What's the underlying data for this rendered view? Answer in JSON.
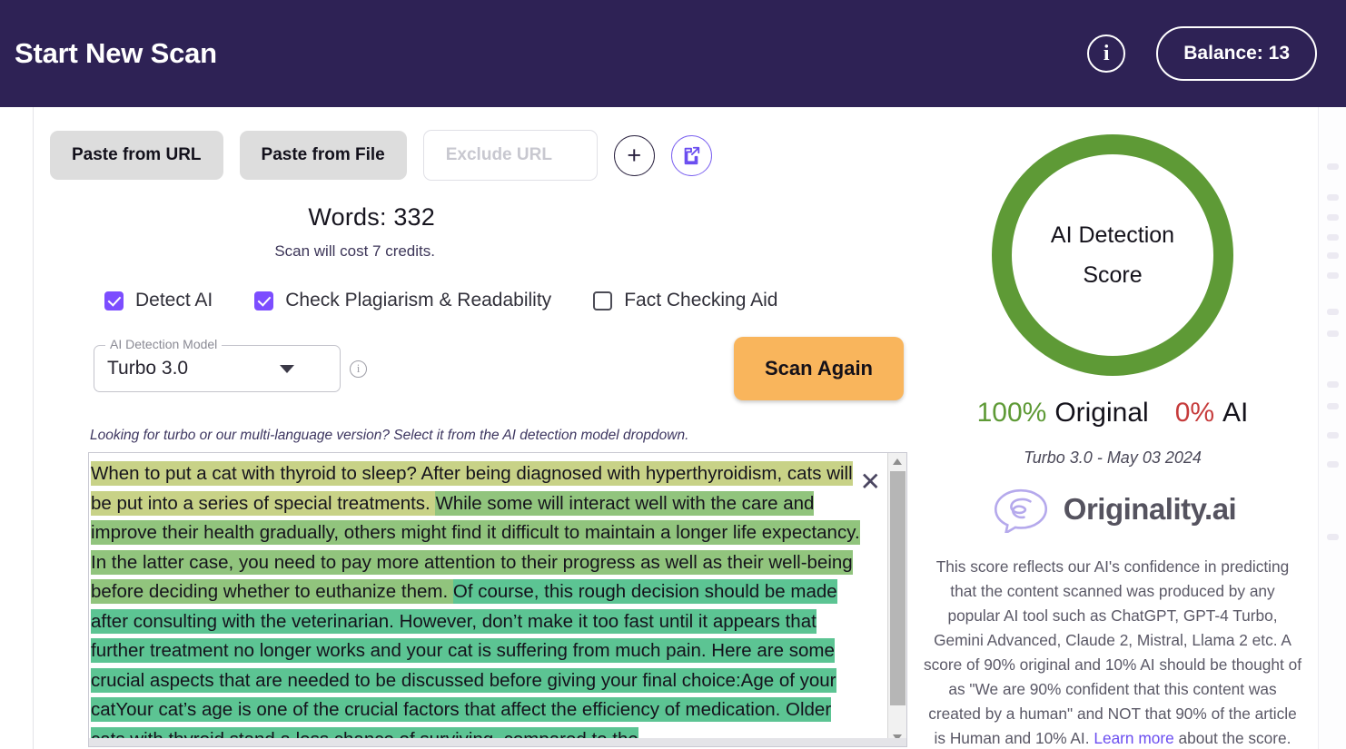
{
  "header": {
    "title": "Start New Scan",
    "info_icon": "info-icon",
    "balance_label": "Balance: 13"
  },
  "toolbar": {
    "paste_url": "Paste from URL",
    "paste_file": "Paste from File",
    "exclude_url_placeholder": "Exclude URL",
    "add_icon": "+",
    "share_icon": "external-link-icon"
  },
  "stats": {
    "words": "Words: 332",
    "cost": "Scan will cost 7 credits."
  },
  "options": [
    {
      "label": "Detect AI",
      "checked": true
    },
    {
      "label": "Check Plagiarism & Readability",
      "checked": true
    },
    {
      "label": "Fact Checking Aid",
      "checked": false
    }
  ],
  "model": {
    "legend": "AI Detection Model",
    "value": "Turbo 3.0"
  },
  "scan_button": "Scan Again",
  "hint": "Looking for turbo or our multi-language version? Select it from the AI detection model dropdown.",
  "editor": {
    "segments": [
      {
        "class": "seg-a",
        "text": "When to put a cat with thyroid to sleep? After being diagnosed with hyperthyroidism, cats will be put into a series of special treatments. "
      },
      {
        "class": "seg-b",
        "text": "While some will interact well with the care and improve their health gradually, others might find it difficult to maintain a longer life expectancy. In the latter case, you need to pay more attention to their progress as well as their well-being before deciding whether to euthanize them. "
      },
      {
        "class": "seg-c",
        "text": "Of course, this rough decision should be made after consulting with the veterinarian. However, don’t make it too fast until it appears that further treatment no longer works and your cat is suffering from much pain. Here are some crucial aspects that are needed to be discussed before giving your final choice:Age of your catYour cat’s age is one of the crucial factors that affect the efficiency of medication. Older cats with thyroid stand a less chance of surviving, compared to the"
      }
    ],
    "close_icon": "close-icon"
  },
  "result": {
    "ring_line1": "AI Detection",
    "ring_line2": "Score",
    "original_pct": "100%",
    "original_label": "Original",
    "ai_pct": "0%",
    "ai_label": "AI",
    "model_date": "Turbo 3.0 - May 03 2024",
    "brand": "Originality.ai",
    "explanation_a": "This score reflects our AI's confidence in predicting that the content scanned was produced by any popular AI tool such as ChatGPT, GPT-4 Turbo, Gemini Advanced, Claude 2, Mistral, Llama 2 etc. A score of 90% original and 10% AI should be thought of as \"We are 90% confident that this content was created by a human\" and NOT that 90% of the article is Human and 10% AI. ",
    "explanation_link": "Learn more",
    "explanation_b": " about the score."
  },
  "colors": {
    "header_bg": "#2e2255",
    "accent_violet": "#7c4dff",
    "scan_orange": "#f9b55c",
    "score_green": "#5e9a36",
    "ai_red": "#c63b3b",
    "seg_a": "#c8d287",
    "seg_b": "#91c47d",
    "seg_c": "#5cc493"
  }
}
